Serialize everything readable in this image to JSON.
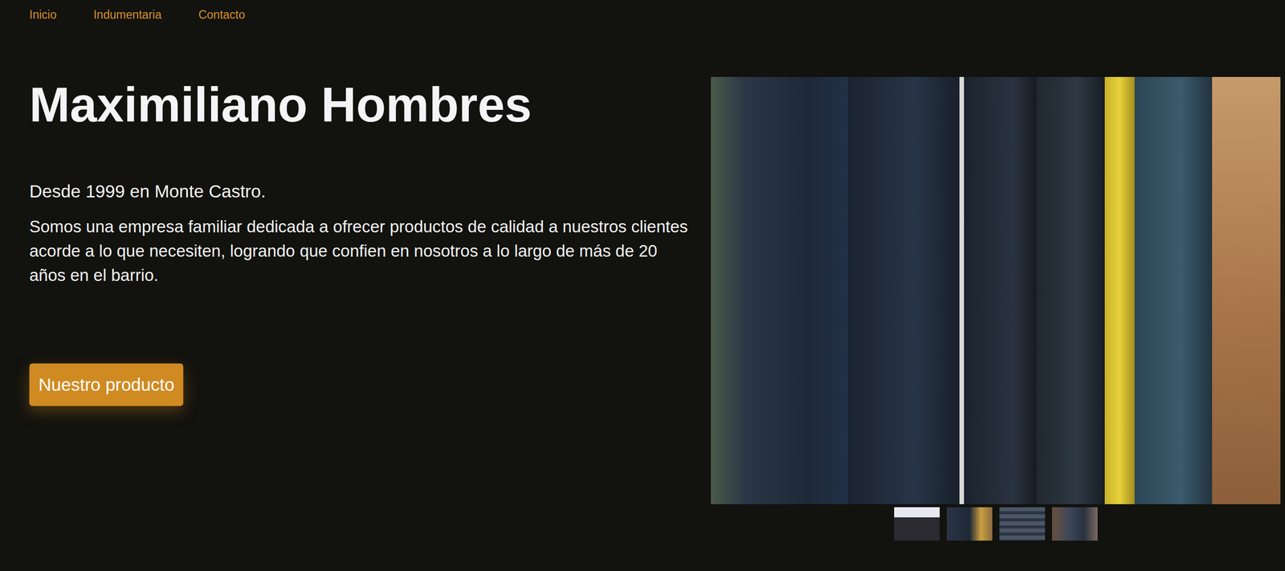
{
  "nav": {
    "items": [
      {
        "label": "Inicio"
      },
      {
        "label": "Indumentaria"
      },
      {
        "label": "Contacto"
      }
    ]
  },
  "hero": {
    "title": "Maximiliano Hombres",
    "subtitle": "Desde 1999 en Monte Castro.",
    "description": "Somos una empresa familiar dedicada a ofrecer productos de calidad a nuestros clientes acorde a lo que necesiten, logrando que confien en nosotros a lo largo de más de 20 años en el barrio.",
    "button": "Nuestro producto"
  },
  "gallery": {
    "thumbnails": [
      {
        "kind": "storefront"
      },
      {
        "kind": "jackets"
      },
      {
        "kind": "shelves"
      },
      {
        "kind": "racks"
      }
    ]
  }
}
